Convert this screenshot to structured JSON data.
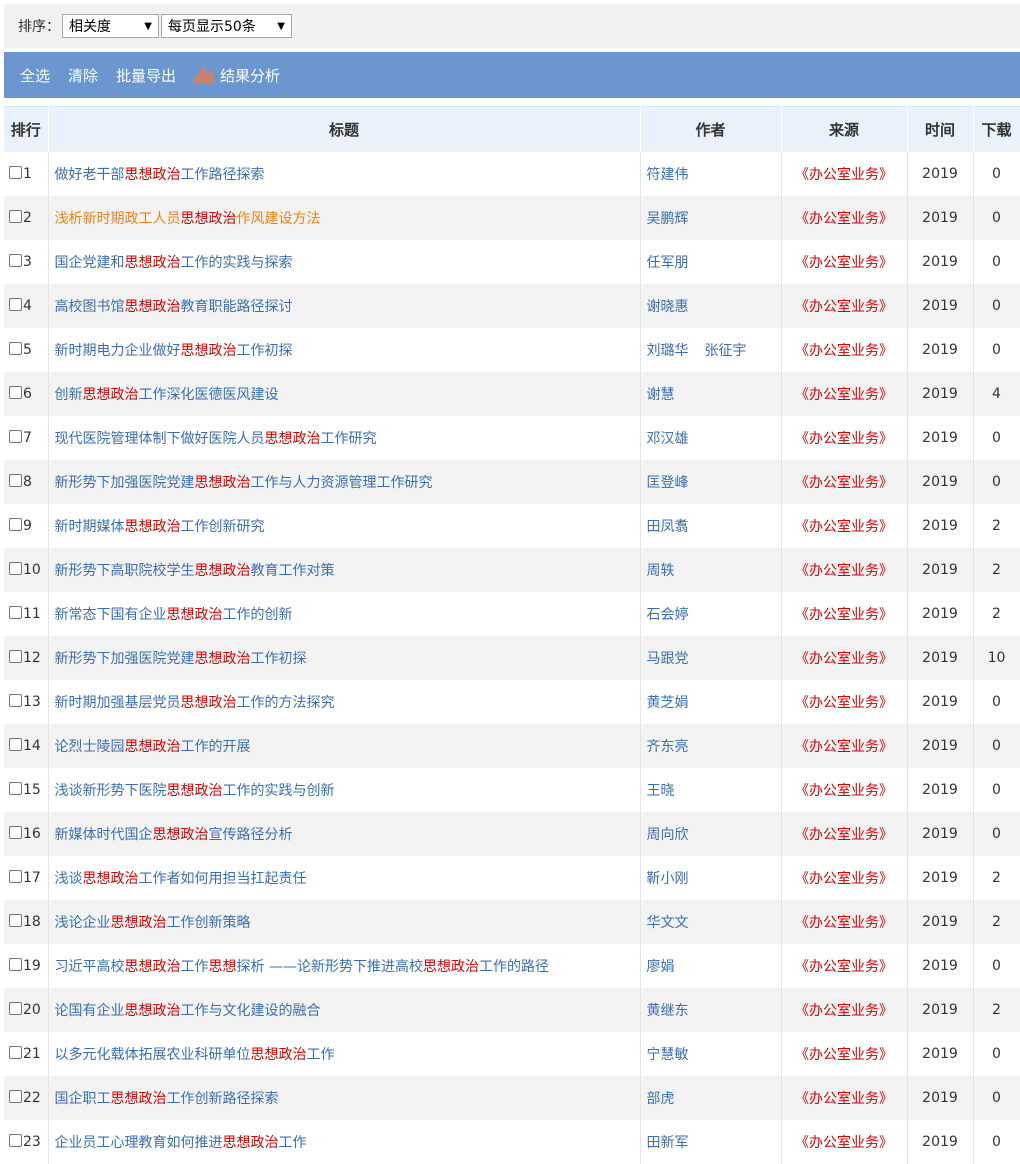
{
  "sort": {
    "label": "排序：",
    "order_value": "相关度",
    "pagesize_value": "每页显示50条"
  },
  "toolbar": {
    "select_all": "全选",
    "clear": "清除",
    "batch_export": "批量导出",
    "analysis": "结果分析"
  },
  "columns": {
    "rank": "排行",
    "title": "标题",
    "author": "作者",
    "source": "来源",
    "year": "时间",
    "downloads": "下载"
  },
  "highlight_color": "#d50000",
  "link_color": "#3a6eb0",
  "visited_color": "#e8831a",
  "rows": [
    {
      "rank": "1",
      "title": [
        "做好老干部",
        "思想政治",
        "工作路径探索"
      ],
      "authors": [
        "符建伟"
      ],
      "source": "《办公室业务》",
      "year": "2019",
      "downloads": "0"
    },
    {
      "rank": "2",
      "title": [
        "浅析新时期政工人员",
        "思想政治",
        "作风建设方法"
      ],
      "authors": [
        "吴鹏辉"
      ],
      "source": "《办公室业务》",
      "year": "2019",
      "downloads": "0",
      "visited": true
    },
    {
      "rank": "3",
      "title": [
        "国企党建和",
        "思想政治",
        "工作的实践与探索"
      ],
      "authors": [
        "任军朋"
      ],
      "source": "《办公室业务》",
      "year": "2019",
      "downloads": "0"
    },
    {
      "rank": "4",
      "title": [
        "高校图书馆",
        "思想政治",
        "教育职能路径探讨"
      ],
      "authors": [
        "谢晓惠"
      ],
      "source": "《办公室业务》",
      "year": "2019",
      "downloads": "0"
    },
    {
      "rank": "5",
      "title": [
        "新时期电力企业做好",
        "思想政治",
        "工作初探"
      ],
      "authors": [
        "刘璐华",
        "张征宇"
      ],
      "source": "《办公室业务》",
      "year": "2019",
      "downloads": "0"
    },
    {
      "rank": "6",
      "title": [
        "创新",
        "思想政治",
        "工作深化医德医风建设"
      ],
      "authors": [
        "谢慧"
      ],
      "source": "《办公室业务》",
      "year": "2019",
      "downloads": "4"
    },
    {
      "rank": "7",
      "title": [
        "现代医院管理体制下做好医院人员",
        "思想政治",
        "工作研究"
      ],
      "authors": [
        "邓汉雄"
      ],
      "source": "《办公室业务》",
      "year": "2019",
      "downloads": "0"
    },
    {
      "rank": "8",
      "title": [
        "新形势下加强医院党建",
        "思想政治",
        "工作与人力资源管理工作研究"
      ],
      "authors": [
        "匡登峰"
      ],
      "source": "《办公室业务》",
      "year": "2019",
      "downloads": "0"
    },
    {
      "rank": "9",
      "title": [
        "新时期媒体",
        "思想政治",
        "工作创新研究"
      ],
      "authors": [
        "田凤翥"
      ],
      "source": "《办公室业务》",
      "year": "2019",
      "downloads": "2"
    },
    {
      "rank": "10",
      "title": [
        "新形势下高职院校学生",
        "思想政治",
        "教育工作对策"
      ],
      "authors": [
        "周轶"
      ],
      "source": "《办公室业务》",
      "year": "2019",
      "downloads": "2"
    },
    {
      "rank": "11",
      "title": [
        "新常态下国有企业",
        "思想政治",
        "工作的创新"
      ],
      "authors": [
        "石会婷"
      ],
      "source": "《办公室业务》",
      "year": "2019",
      "downloads": "2"
    },
    {
      "rank": "12",
      "title": [
        "新形势下加强医院党建",
        "思想政治",
        "工作初探"
      ],
      "authors": [
        "马跟党"
      ],
      "source": "《办公室业务》",
      "year": "2019",
      "downloads": "10"
    },
    {
      "rank": "13",
      "title": [
        "新时期加强基层党员",
        "思想政治",
        "工作的方法探究"
      ],
      "authors": [
        "黄芝娟"
      ],
      "source": "《办公室业务》",
      "year": "2019",
      "downloads": "0"
    },
    {
      "rank": "14",
      "title": [
        "论烈士陵园",
        "思想政治",
        "工作的开展"
      ],
      "authors": [
        "齐东亮"
      ],
      "source": "《办公室业务》",
      "year": "2019",
      "downloads": "0"
    },
    {
      "rank": "15",
      "title": [
        "浅谈新形势下医院",
        "思想政治",
        "工作的实践与创新"
      ],
      "authors": [
        "王晓"
      ],
      "source": "《办公室业务》",
      "year": "2019",
      "downloads": "0"
    },
    {
      "rank": "16",
      "title": [
        "新媒体时代国企",
        "思想政治",
        "宣传路径分析"
      ],
      "authors": [
        "周向欣"
      ],
      "source": "《办公室业务》",
      "year": "2019",
      "downloads": "0"
    },
    {
      "rank": "17",
      "title": [
        "浅谈",
        "思想政治",
        "工作者如何用担当扛起责任"
      ],
      "authors": [
        "靳小刚"
      ],
      "source": "《办公室业务》",
      "year": "2019",
      "downloads": "2"
    },
    {
      "rank": "18",
      "title": [
        "浅论企业",
        "思想政治",
        "工作创新策略"
      ],
      "authors": [
        "华文文"
      ],
      "source": "《办公室业务》",
      "year": "2019",
      "downloads": "2"
    },
    {
      "rank": "19",
      "title": [
        "习近平高校",
        "思想政治",
        "工作",
        "思想",
        "探析 ——论新形势下推进高校",
        "思想政治",
        "工作的路径"
      ],
      "authors": [
        "廖娟"
      ],
      "source": "《办公室业务》",
      "year": "2019",
      "downloads": "0"
    },
    {
      "rank": "20",
      "title": [
        "论国有企业",
        "思想政治",
        "工作与文化建设的融合"
      ],
      "authors": [
        "黄继东"
      ],
      "source": "《办公室业务》",
      "year": "2019",
      "downloads": "2"
    },
    {
      "rank": "21",
      "title": [
        "以多元化载体拓展农业科研单位",
        "思想政治",
        "工作"
      ],
      "authors": [
        "宁慧敏"
      ],
      "source": "《办公室业务》",
      "year": "2019",
      "downloads": "0"
    },
    {
      "rank": "22",
      "title": [
        "国企职工",
        "思想政治",
        "工作创新路径探索"
      ],
      "authors": [
        "部虎"
      ],
      "source": "《办公室业务》",
      "year": "2019",
      "downloads": "0"
    },
    {
      "rank": "23",
      "title": [
        "企业员工心理教育如何推进",
        "思想政治",
        "工作"
      ],
      "authors": [
        "田新军"
      ],
      "source": "《办公室业务》",
      "year": "2019",
      "downloads": "0"
    }
  ]
}
